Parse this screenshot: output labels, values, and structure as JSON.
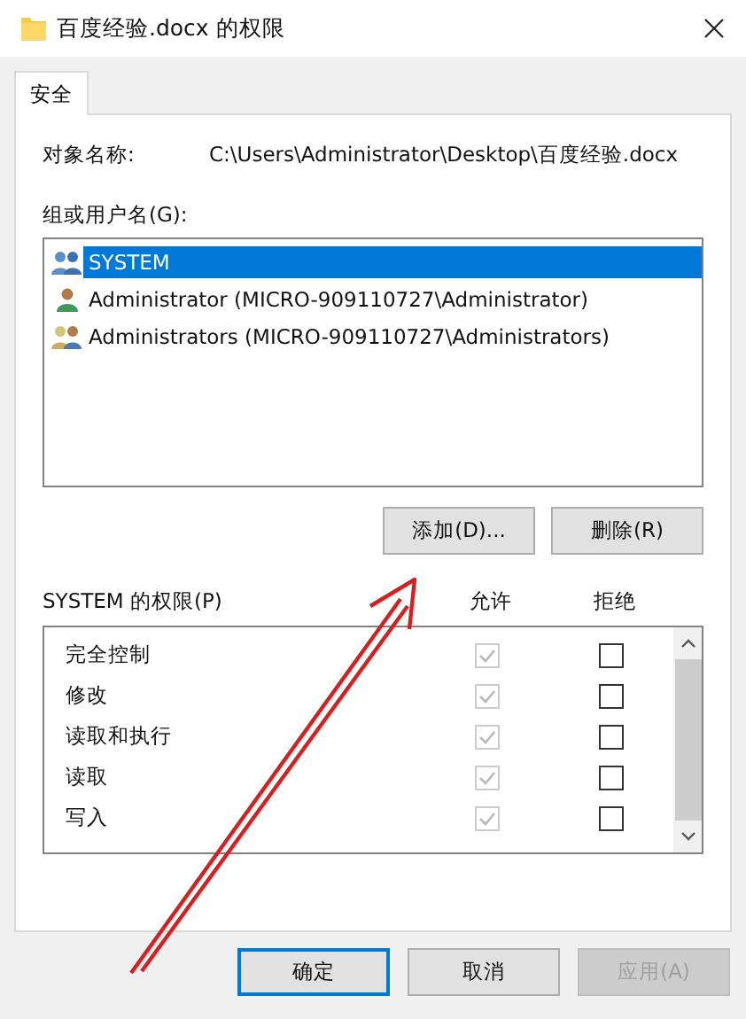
{
  "window": {
    "title": "百度经验.docx 的权限"
  },
  "tabs": [
    {
      "label": "安全",
      "selected": true
    }
  ],
  "object_name": {
    "label": "对象名称:",
    "value": "C:\\Users\\Administrator\\Desktop\\百度经验.docx"
  },
  "groups": {
    "label": "组或用户名(G):",
    "users": [
      {
        "name": "SYSTEM",
        "kind": "system",
        "selected": true
      },
      {
        "name": "Administrator (MICRO-909110727\\Administrator)",
        "kind": "user",
        "selected": false
      },
      {
        "name": "Administrators (MICRO-909110727\\Administrators)",
        "kind": "group",
        "selected": false
      }
    ],
    "buttons": [
      "添加(D)...",
      "删除(R)"
    ]
  },
  "permissions": {
    "title": "SYSTEM 的权限(P)",
    "columns": [
      "允许",
      "拒绝"
    ],
    "rows": [
      {
        "name": "完全控制",
        "allow": {
          "checked": true,
          "disabled": true
        },
        "deny": {
          "checked": false,
          "disabled": false
        }
      },
      {
        "name": "修改",
        "allow": {
          "checked": true,
          "disabled": true
        },
        "deny": {
          "checked": false,
          "disabled": false
        }
      },
      {
        "name": "读取和执行",
        "allow": {
          "checked": true,
          "disabled": true
        },
        "deny": {
          "checked": false,
          "disabled": false
        }
      },
      {
        "name": "读取",
        "allow": {
          "checked": true,
          "disabled": true
        },
        "deny": {
          "checked": false,
          "disabled": false
        }
      },
      {
        "name": "写入",
        "allow": {
          "checked": true,
          "disabled": true
        },
        "deny": {
          "checked": false,
          "disabled": false
        }
      }
    ]
  },
  "footer_buttons": [
    {
      "label": "确定",
      "default": true,
      "disabled": false
    },
    {
      "label": "取消",
      "default": false,
      "disabled": false
    },
    {
      "label": "应用(A)",
      "default": false,
      "disabled": true
    }
  ],
  "annotation": {
    "kind": "arrow"
  }
}
